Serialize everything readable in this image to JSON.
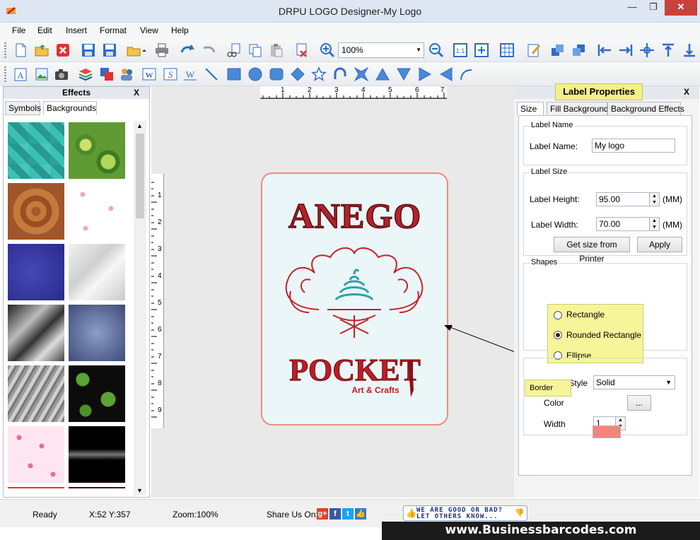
{
  "window": {
    "title": "DRPU LOGO Designer-My Logo",
    "close_glyph": "✕",
    "max_glyph": "❐",
    "min_glyph": "—"
  },
  "menu": [
    "File",
    "Edit",
    "Insert",
    "Format",
    "View",
    "Help"
  ],
  "toolbar": {
    "zoom_value": "100%"
  },
  "effects": {
    "title": "Effects",
    "close_glyph": "X",
    "tabs": [
      "Symbols",
      "Backgrounds"
    ],
    "active_tab": "Backgrounds"
  },
  "rulers": {
    "horizontal": [
      "1",
      "2",
      "3",
      "4",
      "5",
      "6",
      "7"
    ],
    "vertical": [
      "1",
      "2",
      "3",
      "4",
      "5",
      "6",
      "7",
      "8",
      "9"
    ]
  },
  "label_canvas": {
    "heading": "ANEGO",
    "brand": "POCKET",
    "tagline": "Art & Crafts"
  },
  "properties": {
    "title": "Label Properties",
    "close_glyph": "X",
    "tabs": [
      "Size",
      "Fill Background",
      "Background Effects"
    ],
    "active_tab": "Size",
    "label_name_group": "Label Name",
    "label_name_caption": "Label Name:",
    "label_name_value": "My logo",
    "label_size_group": "Label Size",
    "height_caption": "Label Height:",
    "height_value": "95.00",
    "width_caption": "Label Width:",
    "width_value": "70.00",
    "unit": "(MM)",
    "get_size_button": "Get size from Printer",
    "apply_button": "Apply",
    "shapes_group": "Shapes",
    "shapes": [
      "Rectangle",
      "Rounded Rectangle",
      "Ellipse"
    ],
    "selected_shape": "Rounded Rectangle",
    "border_group": "Border",
    "border_style_caption": "Border Style",
    "border_style_value": "Solid",
    "color_caption": "Color",
    "color_value": "#f4857a",
    "color_button": "...",
    "width_caption_border": "Width",
    "border_width_value": "1"
  },
  "status": {
    "state": "Ready",
    "coords": "X:52  Y:357",
    "zoom": "Zoom:100%",
    "share": "Share Us On:",
    "feedback_line1": "WE ARE GOOD OR BAD?",
    "feedback_line2": "LET OTHERS KNOW..."
  },
  "footer": "www.Businessbarcodes.com",
  "colors": {
    "accent_red": "#b0222a",
    "border_salmon": "#f08a80",
    "highlight_yellow": "#f7f59a"
  }
}
